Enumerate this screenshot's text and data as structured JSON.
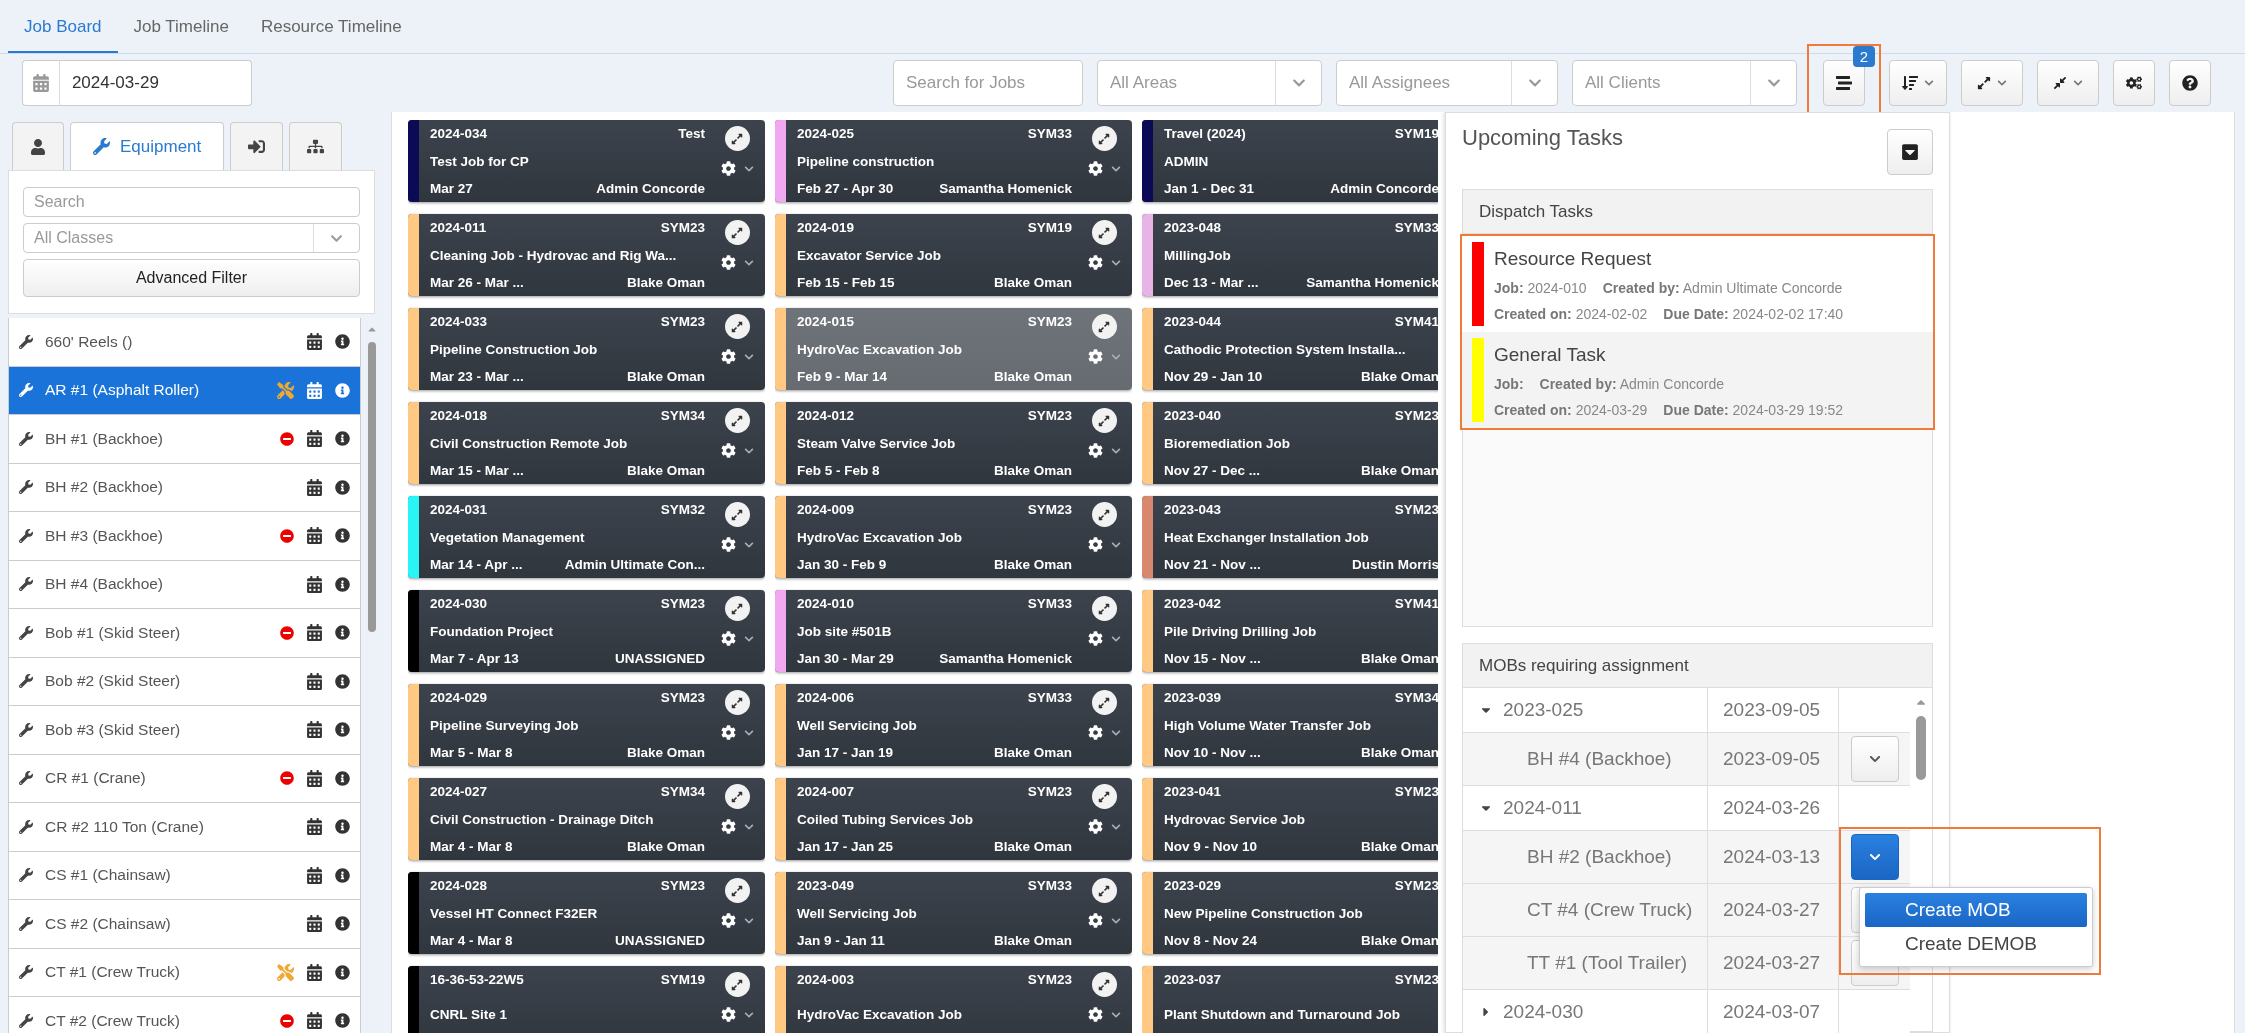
{
  "nav_tabs": [
    {
      "label": "Job Board",
      "selected": true
    },
    {
      "label": "Job Timeline",
      "selected": false
    },
    {
      "label": "Resource Timeline",
      "selected": false
    }
  ],
  "toolbar": {
    "date": "2024-03-29",
    "search": {
      "placeholder": "Search for Jobs"
    },
    "filters": [
      {
        "placeholder": "All Areas"
      },
      {
        "placeholder": "All Assignees"
      },
      {
        "placeholder": "All Clients"
      }
    ],
    "task_badge": "2",
    "tasks_highlighted": true
  },
  "resource_panel": {
    "tabs": [
      {
        "kind": "person",
        "selected": false
      },
      {
        "kind": "equipment",
        "label": "Equipment",
        "selected": true
      },
      {
        "kind": "login",
        "selected": false
      },
      {
        "kind": "hierarchy",
        "selected": false
      }
    ],
    "search": {
      "placeholder": "Search"
    },
    "class_filter": {
      "placeholder": "All Classes"
    },
    "advanced_filter": "Advanced Filter",
    "items": [
      {
        "name": "660' Reels ()",
        "selected": false,
        "maintenance": false,
        "unavailable": false
      },
      {
        "name": "AR #1 (Asphalt Roller)",
        "selected": true,
        "maintenance": true,
        "unavailable": false
      },
      {
        "name": "BH #1 (Backhoe)",
        "selected": false,
        "maintenance": false,
        "unavailable": true
      },
      {
        "name": "BH #2 (Backhoe)",
        "selected": false,
        "maintenance": false,
        "unavailable": false
      },
      {
        "name": "BH #3 (Backhoe)",
        "selected": false,
        "maintenance": false,
        "unavailable": true
      },
      {
        "name": "BH #4 (Backhoe)",
        "selected": false,
        "maintenance": false,
        "unavailable": false
      },
      {
        "name": "Bob #1 (Skid Steer)",
        "selected": false,
        "maintenance": false,
        "unavailable": true
      },
      {
        "name": "Bob #2 (Skid Steer)",
        "selected": false,
        "maintenance": false,
        "unavailable": false
      },
      {
        "name": "Bob #3 (Skid Steer)",
        "selected": false,
        "maintenance": false,
        "unavailable": false
      },
      {
        "name": "CR #1 (Crane)",
        "selected": false,
        "maintenance": false,
        "unavailable": true
      },
      {
        "name": "CR #2 110 Ton (Crane)",
        "selected": false,
        "maintenance": false,
        "unavailable": false
      },
      {
        "name": "CS #1 (Chainsaw)",
        "selected": false,
        "maintenance": false,
        "unavailable": false
      },
      {
        "name": "CS #2 (Chainsaw)",
        "selected": false,
        "maintenance": false,
        "unavailable": false
      },
      {
        "name": "CT #1 (Crew Truck)",
        "selected": false,
        "maintenance": true,
        "unavailable": false
      },
      {
        "name": "CT #2 (Crew Truck)",
        "selected": false,
        "maintenance": false,
        "unavailable": true
      }
    ]
  },
  "board": {
    "columns": [
      {
        "cards": [
          {
            "id": "2024-034",
            "client": "Test",
            "title": "Test Job for CP",
            "dates": "Mar 27",
            "assignee": "Admin Concorde",
            "color": "#0b0b55",
            "selected": false
          },
          {
            "id": "2024-011",
            "client": "SYM23",
            "title": "Cleaning Job - Hydrovac and Rig Wa...",
            "dates": "Mar 26 - Mar ...",
            "assignee": "Blake Oman",
            "color": "#ffc983",
            "selected": false
          },
          {
            "id": "2024-033",
            "client": "SYM23",
            "title": "Pipeline Construction Job",
            "dates": "Mar 23 - Mar ...",
            "assignee": "Blake Oman",
            "color": "#ffc983",
            "selected": false
          },
          {
            "id": "2024-018",
            "client": "SYM34",
            "title": "Civil Construction Remote Job",
            "dates": "Mar 15 - Mar ...",
            "assignee": "Blake Oman",
            "color": "#ffc983",
            "selected": false
          },
          {
            "id": "2024-031",
            "client": "SYM32",
            "title": "Vegetation Management",
            "dates": "Mar 14 - Apr ...",
            "assignee": "Admin Ultimate Con...",
            "color": "#2af5f5",
            "selected": false
          },
          {
            "id": "2024-030",
            "client": "SYM23",
            "title": "Foundation Project",
            "dates": "Mar 7 - Apr 13",
            "assignee": "UNASSIGNED",
            "color": "#000000",
            "selected": false
          },
          {
            "id": "2024-029",
            "client": "SYM23",
            "title": "Pipeline Surveying Job",
            "dates": "Mar 5 - Mar 8",
            "assignee": "Blake Oman",
            "color": "#ffc983",
            "selected": false
          },
          {
            "id": "2024-027",
            "client": "SYM34",
            "title": "Civil Construction - Drainage Ditch",
            "dates": "Mar 4 - Mar 8",
            "assignee": "Blake Oman",
            "color": "#ffc983",
            "selected": false
          },
          {
            "id": "2024-028",
            "client": "SYM23",
            "title": "Vessel HT Connect F32ER",
            "dates": "Mar 4 - Mar 8",
            "assignee": "UNASSIGNED",
            "color": "#000000",
            "selected": false
          },
          {
            "id": "16-36-53-22W5",
            "client": "SYM19",
            "title": "CNRL Site 1",
            "color": "#000000",
            "selected": false
          }
        ]
      },
      {
        "cards": [
          {
            "id": "2024-025",
            "client": "SYM33",
            "title": "Pipeline construction",
            "dates": "Feb 27 - Apr 30",
            "assignee": "Samantha Homenick",
            "color": "#f0a8f0",
            "selected": false
          },
          {
            "id": "2024-019",
            "client": "SYM19",
            "title": "Excavator Service Job",
            "dates": "Feb 15 - Feb 15",
            "assignee": "Blake Oman",
            "color": "#ffc983",
            "selected": false
          },
          {
            "id": "2024-015",
            "client": "SYM23",
            "title": "HydroVac Excavation Job",
            "dates": "Feb 9 - Mar 14",
            "assignee": "Blake Oman",
            "color": "#ffc983",
            "selected": true
          },
          {
            "id": "2024-012",
            "client": "SYM23",
            "title": "Steam Valve Service Job",
            "dates": "Feb 5 - Feb 8",
            "assignee": "Blake Oman",
            "color": "#ffc983",
            "selected": false
          },
          {
            "id": "2024-009",
            "client": "SYM23",
            "title": "HydroVac Excavation Job",
            "dates": "Jan 30 - Feb 9",
            "assignee": "Blake Oman",
            "color": "#ffc983",
            "selected": false
          },
          {
            "id": "2024-010",
            "client": "SYM33",
            "title": "Job site #501B",
            "dates": "Jan 30 - Mar 29",
            "assignee": "Samantha Homenick",
            "color": "#f0a8f0",
            "selected": false
          },
          {
            "id": "2024-006",
            "client": "SYM33",
            "title": "Well Servicing Job",
            "dates": "Jan 17 - Jan 19",
            "assignee": "Blake Oman",
            "color": "#ffc983",
            "selected": false
          },
          {
            "id": "2024-007",
            "client": "SYM23",
            "title": "Coiled Tubing Services Job",
            "dates": "Jan 17 - Jan 25",
            "assignee": "Blake Oman",
            "color": "#ffc983",
            "selected": false
          },
          {
            "id": "2023-049",
            "client": "SYM33",
            "title": "Well Servicing Job",
            "dates": "Jan 9 - Jan 11",
            "assignee": "Blake Oman",
            "color": "#ffc983",
            "selected": false
          },
          {
            "id": "2024-003",
            "client": "SYM23",
            "title": "HydroVac Excavation Job",
            "color": "#ffc983",
            "selected": false
          }
        ]
      },
      {
        "cards": [
          {
            "id": "Travel (2024)",
            "client": "SYM19",
            "title": "ADMIN",
            "dates": "Jan 1 - Dec 31",
            "assignee": "Admin Concorde",
            "color": "#0b0b55",
            "selected": false
          },
          {
            "id": "2023-048",
            "client": "SYM33",
            "title": "MillingJob",
            "dates": "Dec 13 - Mar ...",
            "assignee": "Samantha Homenick",
            "color": "#e8b4e8",
            "selected": false
          },
          {
            "id": "2023-044",
            "client": "SYM41",
            "title": "Cathodic Protection System Installa...",
            "dates": "Nov 29 - Jan 10",
            "assignee": "Blake Oman",
            "color": "#ffc983",
            "selected": false
          },
          {
            "id": "2023-040",
            "client": "SYM23",
            "title": "Bioremediation Job",
            "dates": "Nov 27 - Dec ...",
            "assignee": "Blake Oman",
            "color": "#ffc983",
            "selected": false
          },
          {
            "id": "2023-043",
            "client": "SYM23",
            "title": "Heat Exchanger Installation Job",
            "dates": "Nov 21 - Nov ...",
            "assignee": "Dustin Morris",
            "color": "#d98870",
            "selected": false
          },
          {
            "id": "2023-042",
            "client": "SYM41",
            "title": "Pile Driving Drilling Job",
            "dates": "Nov 15 - Nov ...",
            "assignee": "Blake Oman",
            "color": "#ffc983",
            "selected": false
          },
          {
            "id": "2023-039",
            "client": "SYM34",
            "title": "High Volume Water Transfer Job",
            "dates": "Nov 10 - Nov ...",
            "assignee": "Blake Oman",
            "color": "#ffc983",
            "selected": false
          },
          {
            "id": "2023-041",
            "client": "SYM23",
            "title": "Hydrovac Service Job",
            "dates": "Nov 9 - Nov 10",
            "assignee": "Blake Oman",
            "color": "#ffc983",
            "selected": false
          },
          {
            "id": "2023-029",
            "client": "SYM23",
            "title": "New Pipeline Construction Job",
            "dates": "Nov 8 - Nov 24",
            "assignee": "Blake Oman",
            "color": "#ffc983",
            "selected": false
          },
          {
            "id": "2023-037",
            "client": "SYM23",
            "title": "Plant Shutdown and Turnaround Job",
            "color": "#ffc983",
            "selected": false
          }
        ]
      }
    ]
  },
  "upcoming_tasks": {
    "title": "Upcoming Tasks",
    "dispatch": {
      "title": "Dispatch Tasks",
      "highlighted": true,
      "tasks": [
        {
          "title": "Resource Request",
          "color": "#ff0000",
          "selected": false,
          "lines": [
            [
              {
                "label": "Job:",
                "value": "2024-010"
              },
              {
                "label": "Created by:",
                "value": "Admin Ultimate Concorde"
              }
            ],
            [
              {
                "label": "Created on:",
                "value": "2024-02-02"
              },
              {
                "label": "Due Date:",
                "value": "2024-02-02 17:40"
              }
            ]
          ]
        },
        {
          "title": "General Task",
          "color": "#ffff00",
          "selected": true,
          "lines": [
            [
              {
                "label": "Job:"
              },
              {
                "label": "Created by:",
                "value": "Admin Concorde"
              }
            ],
            [
              {
                "label": "Created on:",
                "value": "2024-03-29"
              },
              {
                "label": "Due Date:",
                "value": "2024-03-29 19:52"
              }
            ]
          ]
        }
      ]
    },
    "mobs": {
      "title": "MOBs requiring assignment",
      "rows": [
        {
          "kind": "group",
          "name": "2023-025",
          "date": "2023-09-05",
          "expanded": true
        },
        {
          "kind": "item",
          "name": "BH #4 (Backhoe)",
          "date": "2023-09-05",
          "active": false
        },
        {
          "kind": "group",
          "name": "2024-011",
          "date": "2024-03-26",
          "expanded": true
        },
        {
          "kind": "item",
          "name": "BH #2 (Backhoe)",
          "date": "2024-03-13",
          "active": true,
          "menu": {
            "highlighted": true,
            "items": [
              {
                "label": "Create MOB",
                "selected": true
              },
              {
                "label": "Create DEMOB",
                "selected": false
              }
            ]
          }
        },
        {
          "kind": "item",
          "name": "CT #4 (Crew Truck)",
          "date": "2024-03-27"
        },
        {
          "kind": "item",
          "name": "TT #1 (Tool Trailer)",
          "date": "2024-03-27",
          "active": false
        },
        {
          "kind": "group",
          "name": "2024-030",
          "date": "2024-03-07",
          "expanded": false
        }
      ]
    }
  }
}
